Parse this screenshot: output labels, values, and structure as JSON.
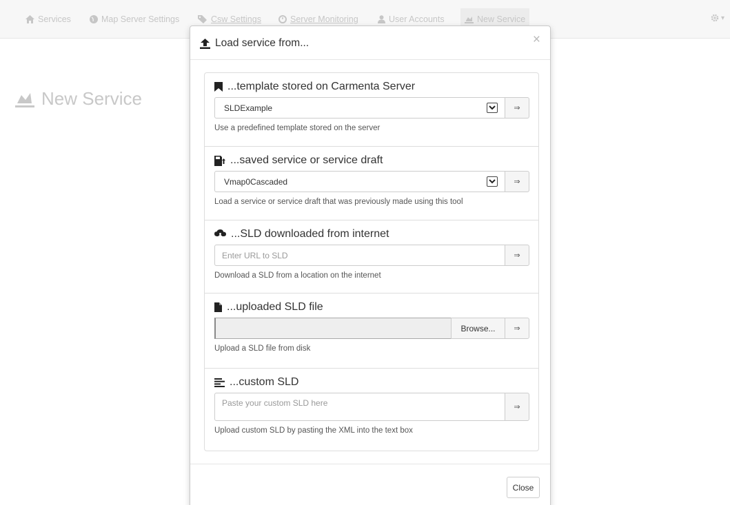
{
  "navbar": {
    "items": [
      {
        "label": "Services",
        "icon": "home-icon"
      },
      {
        "label": "Map Server Settings",
        "icon": "globe-icon"
      },
      {
        "label": "Csw Settings",
        "icon": "tags-icon"
      },
      {
        "label": "Server Monitoring",
        "icon": "dashboard-icon"
      },
      {
        "label": "User Accounts",
        "icon": "user-icon"
      },
      {
        "label": "New Service",
        "icon": "new-service-icon"
      }
    ],
    "settings_icon": "gear-icon"
  },
  "page": {
    "title": "New Service"
  },
  "modal": {
    "title": "Load service from...",
    "close_glyph": "×",
    "options": [
      {
        "heading": "...template stored on Carmenta Server",
        "icon": "bookmark-icon",
        "selected_value": "SLDExample",
        "help": "Use a predefined template stored on the server"
      },
      {
        "heading": "...saved service or service draft",
        "icon": "saved-file-icon",
        "selected_value": "Vmap0Cascaded",
        "help": "Load a service or service draft that was previously made using this tool"
      },
      {
        "heading": "...SLD downloaded from internet",
        "icon": "cloud-download-icon",
        "placeholder": "Enter URL to SLD",
        "help": "Download a SLD from a location on the internet"
      },
      {
        "heading": "...uploaded SLD file",
        "icon": "file-icon",
        "browse_label": "Browse...",
        "help": "Upload a SLD file from disk"
      },
      {
        "heading": "...custom SLD",
        "icon": "text-left-icon",
        "placeholder": "Paste your custom SLD here",
        "help": "Upload custom SLD by pasting the XML into the text box"
      }
    ],
    "go_glyph": "⇒",
    "close_label": "Close"
  },
  "colors": {
    "nav_text": "#c6c6c6",
    "border": "#dddddd",
    "text": "#333333"
  }
}
